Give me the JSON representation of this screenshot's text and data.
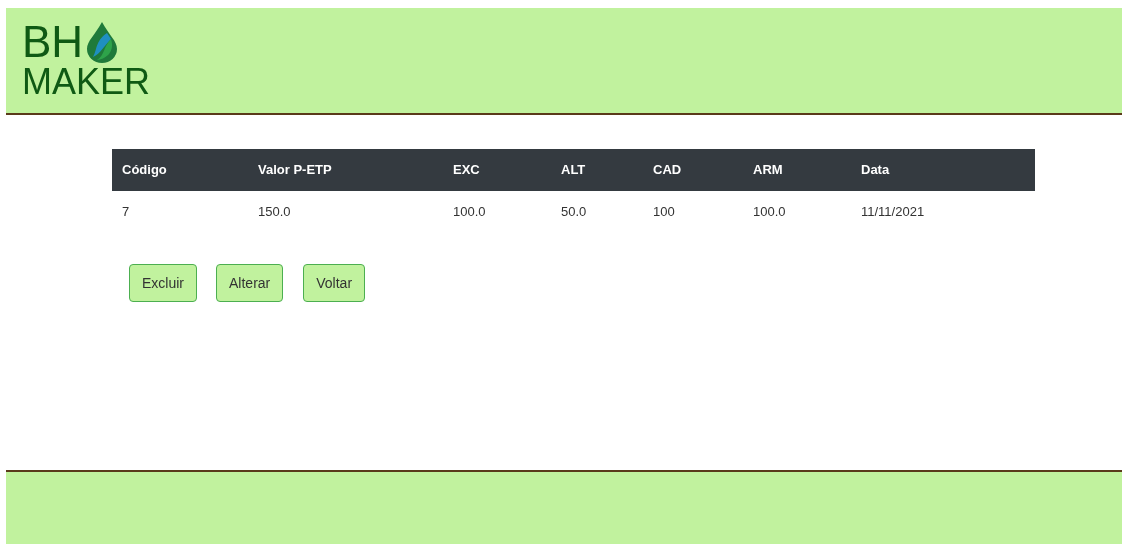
{
  "logo": {
    "line_1": "BH",
    "line_2": "MAKER"
  },
  "table": {
    "columns": [
      "Código",
      "Valor P-ETP",
      "EXC",
      "ALT",
      "CAD",
      "ARM",
      "Data"
    ],
    "rows": [
      [
        "7",
        "150.0",
        "100.0",
        "50.0",
        "100",
        "100.0",
        "11/11/2021"
      ]
    ]
  },
  "buttons": [
    "Excluir",
    "Alterar",
    "Voltar"
  ]
}
